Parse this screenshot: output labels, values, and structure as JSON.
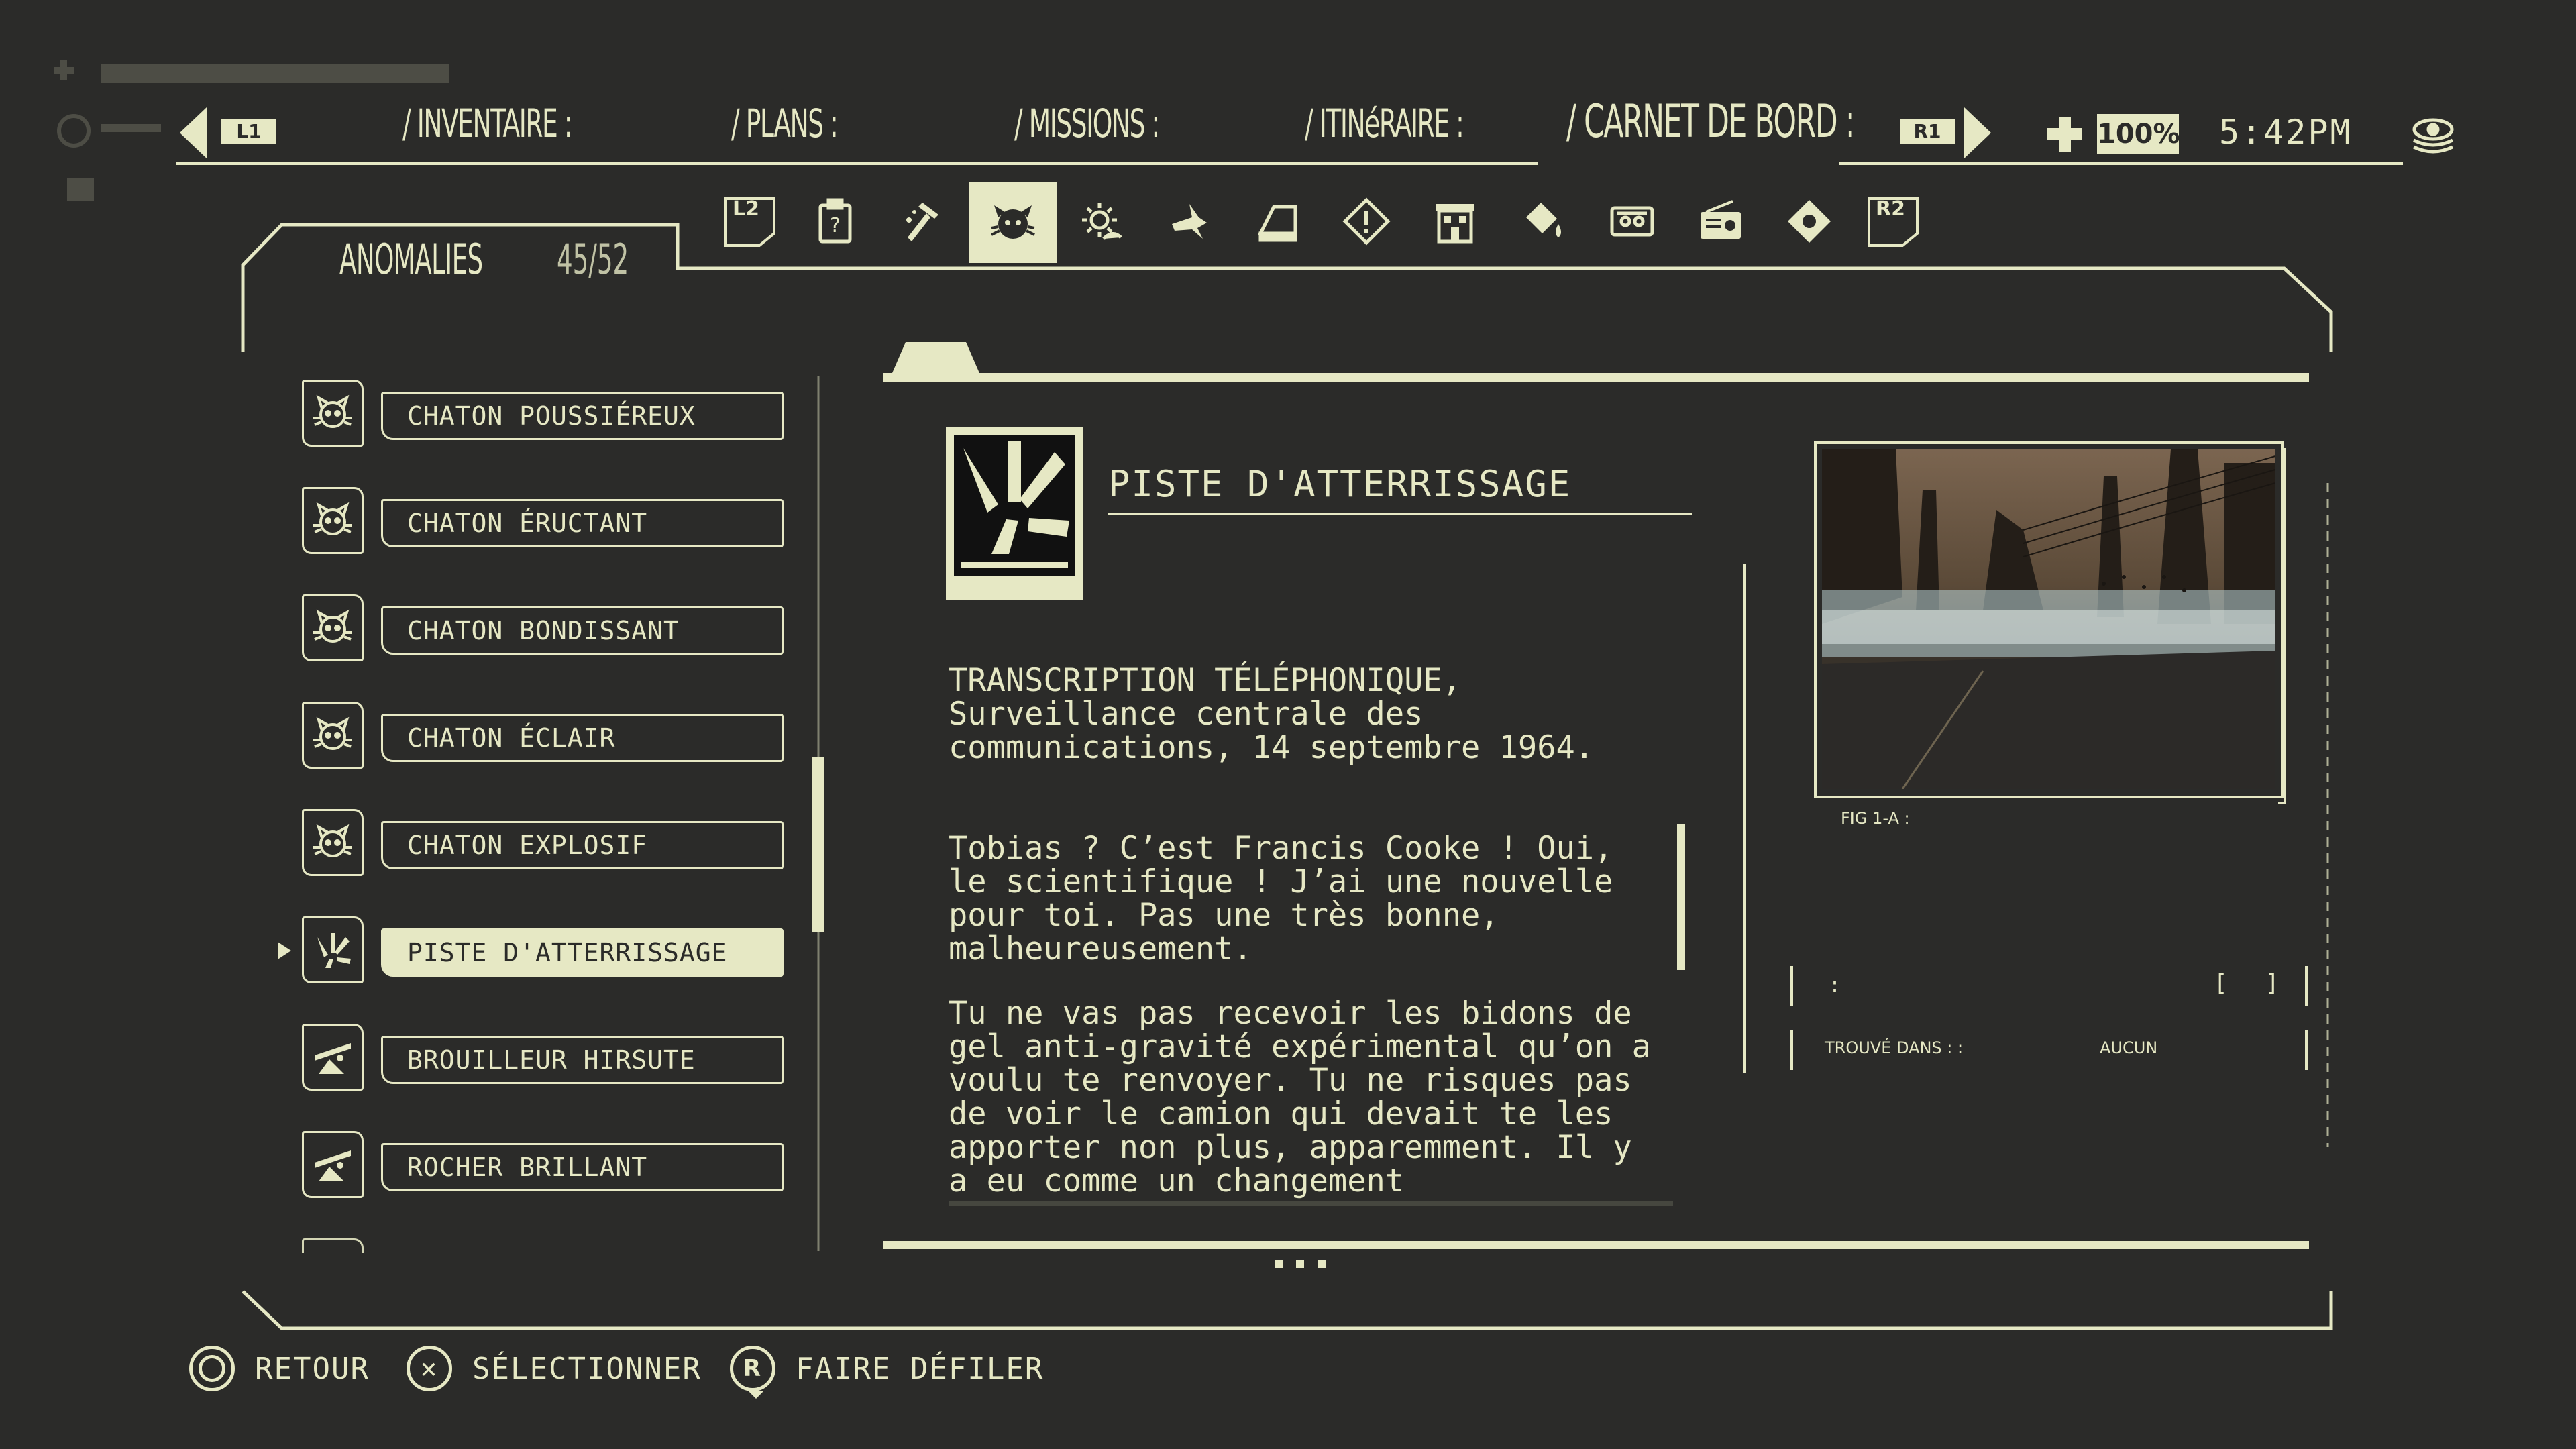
{
  "nav": {
    "l1": "L1",
    "r1": "R1",
    "tabs": [
      {
        "label": "/ INVENTAIRE :"
      },
      {
        "label": "/ PLANS :"
      },
      {
        "label": "/ MISSIONS :"
      },
      {
        "label": "/ ITINéRAIRE :"
      },
      {
        "label": "/ CARNET DE BORD :"
      }
    ],
    "health_percent": "100%",
    "time": "5:42PM"
  },
  "category_bar": {
    "l2": "L2",
    "r2": "R2",
    "icons": [
      "clipboard-icon",
      "hammer-icon",
      "anomaly-kitten-icon",
      "sun-icon",
      "bird-icon",
      "book-icon",
      "warning-diamond-icon",
      "building-icon",
      "paint-bucket-icon",
      "ticket-icon",
      "radio-icon",
      "location-diamond-icon"
    ],
    "active_icon": "anomaly-kitten-icon"
  },
  "panel": {
    "title": "ANOMALIES",
    "count": "45/52"
  },
  "list": [
    {
      "label": "CHATON POUSSIÉREUX",
      "icon": "kitten-icon"
    },
    {
      "label": "CHATON ÉRUCTANT",
      "icon": "kitten-icon"
    },
    {
      "label": "CHATON BONDISSANT",
      "icon": "kitten-icon"
    },
    {
      "label": "CHATON ÉCLAIR",
      "icon": "kitten-icon"
    },
    {
      "label": "CHATON EXPLOSIF",
      "icon": "kitten-icon"
    },
    {
      "label": "PISTE D'ATTERRISSAGE",
      "icon": "landing-strip-icon"
    },
    {
      "label": "BROUILLEUR HIRSUTE",
      "icon": "slope-icon"
    },
    {
      "label": "ROCHER BRILLANT",
      "icon": "slope-icon"
    }
  ],
  "detail": {
    "title": "PISTE D'ATTERRISSAGE",
    "body_1": "TRANSCRIPTION TÉLÉPHONIQUE,\nSurveillance centrale des\ncommunications, 14 septembre 1964.",
    "body_2": "Tobias ? C’est Francis Cooke ! Oui,\nle scientifique ! J’ai une nouvelle\npour toi. Pas une très bonne,\nmalheureusement.",
    "body_3": "Tu ne vas pas recevoir les bidons de\ngel anti-gravité expérimental qu’on a\nvoulu te renvoyer. Tu ne risques pas\nde voir le camion qui devait te les\napporter non plus, apparemment. Il y\na eu comme un changement",
    "fig_label": "FIG 1-A :",
    "info_row_label": ":",
    "info_row_brackets": "[ ]",
    "found_label": "TROUVÉ DANS : :",
    "found_value": "AUCUN"
  },
  "prompts": [
    {
      "label": "RETOUR",
      "glyph": ""
    },
    {
      "label": "SÉLECTIONNER",
      "glyph": "✕"
    },
    {
      "label": "FAIRE DÉFILER",
      "glyph": "R"
    }
  ],
  "colors": {
    "background": "#2b2b29",
    "accent": "#e6e8c4"
  }
}
